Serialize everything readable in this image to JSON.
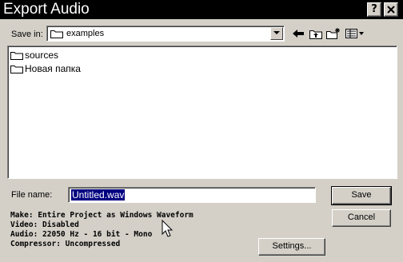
{
  "window": {
    "title": "Export Audio",
    "help_glyph": "?",
    "close_glyph": "X"
  },
  "save_in": {
    "label": "Save in:",
    "value": "examples",
    "icons": [
      "folder-icon",
      "dropdown-arrow-icon",
      "back-arrow-icon",
      "up-folder-icon",
      "new-folder-icon",
      "view-menu-icon"
    ]
  },
  "files": [
    {
      "name": "sources",
      "icon": "folder-icon"
    },
    {
      "name": "Новая папка",
      "icon": "folder-icon"
    }
  ],
  "file_name": {
    "label": "File name:",
    "value": "Untitled.wav"
  },
  "info": {
    "make": "Make: Entire Project as Windows Waveform",
    "video": "Video: Disabled",
    "audio": "Audio: 22050 Hz - 16 bit - Mono",
    "compressor": "Compressor: Uncompressed"
  },
  "buttons": {
    "save": "Save",
    "cancel": "Cancel",
    "settings": "Settings..."
  },
  "colors": {
    "titlebar": "#000000",
    "face": "#d4d0c8",
    "selection": "#000080"
  }
}
